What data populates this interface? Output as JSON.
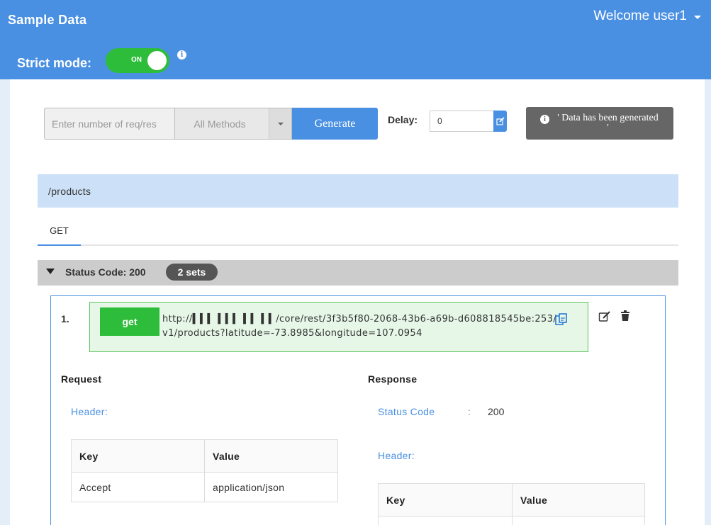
{
  "header": {
    "app_title": "Sample Data",
    "welcome_text": "Welcome user1",
    "strict_mode_label": "Strict mode:",
    "strict_mode_toggle": "ON",
    "info_icon": "i"
  },
  "controls": {
    "req_placeholder": "Enter number of req/res",
    "method_selected": "All Methods",
    "generate_label": "Generate",
    "delay_label": "Delay:",
    "delay_value": "0",
    "toast_icon": "i",
    "toast_text": "' Data has been generated '"
  },
  "endpoint": {
    "path": "/products",
    "tabs": [
      "GET"
    ]
  },
  "status_group": {
    "label": "Status Code: 200",
    "sets_badge": "2 sets"
  },
  "request_set": {
    "index": "1.",
    "method": "get",
    "url": "http://▍▍▍ ▍▍▍ ▍▍ ▍▍/core/rest/3f3b5f80-2068-43b6-a69b-d608818545be:253/v1/products?latitude=-73.8985&longitude=107.0954",
    "request": {
      "heading": "Request",
      "header_label": "Header:",
      "table": {
        "columns": [
          "Key",
          "Value"
        ],
        "rows": [
          [
            "Accept",
            "application/json"
          ]
        ]
      }
    },
    "response": {
      "heading": "Response",
      "status_code_label": "Status Code",
      "separator": ":",
      "status_code_value": "200",
      "header_label": "Header:",
      "table": {
        "columns": [
          "Key",
          "Value"
        ]
      }
    }
  },
  "colors": {
    "primary_blue": "#4a90e2",
    "success_green": "#2ebd3a",
    "path_bar_bg": "#cce0f7",
    "status_bar_bg": "#cccccc"
  }
}
